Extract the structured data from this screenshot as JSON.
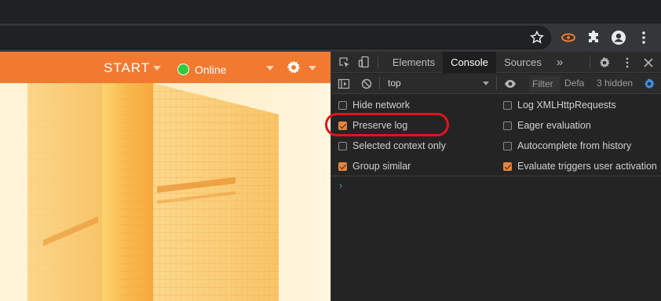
{
  "browser": {
    "icons": [
      "star-icon",
      "extension-orange-icon",
      "puzzle-icon",
      "profile-icon",
      "menu-dots-icon"
    ]
  },
  "page": {
    "start_label": "START",
    "status_label": "Online",
    "status_color": "#2ecc40",
    "accent_color": "#f27a30"
  },
  "devtools": {
    "tabs": [
      {
        "label": "Elements",
        "active": false
      },
      {
        "label": "Console",
        "active": true
      },
      {
        "label": "Sources",
        "active": false
      }
    ],
    "more_tabs": "»",
    "context": "top",
    "filter_placeholder": "Filter",
    "levels": "Defa",
    "hidden_count": "3 hidden",
    "settings": {
      "left": [
        {
          "label": "Hide network",
          "checked": false
        },
        {
          "label": "Preserve log",
          "checked": true
        },
        {
          "label": "Selected context only",
          "checked": false
        },
        {
          "label": "Group similar",
          "checked": true
        }
      ],
      "right": [
        {
          "label": "Log XMLHttpRequests",
          "checked": false
        },
        {
          "label": "Eager evaluation",
          "checked": false
        },
        {
          "label": "Autocomplete from history",
          "checked": false
        },
        {
          "label": "Evaluate triggers user activation",
          "checked": true
        }
      ]
    },
    "prompt": "›",
    "highlight_color": "#e0151a"
  }
}
